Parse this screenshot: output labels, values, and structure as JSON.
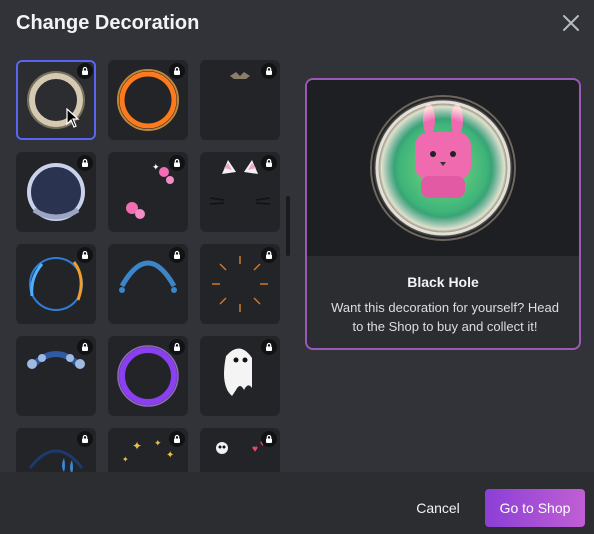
{
  "dialog": {
    "title": "Change Decoration",
    "close_icon": "close-icon"
  },
  "decorations": [
    {
      "id": "black-hole",
      "icon": "black-hole-ring",
      "locked": true,
      "selected": true
    },
    {
      "id": "fire-ring",
      "icon": "fire-ring",
      "locked": true,
      "selected": false
    },
    {
      "id": "small-crown",
      "icon": "tiara",
      "locked": true,
      "selected": false
    },
    {
      "id": "space-helmet",
      "icon": "astronaut-helmet",
      "locked": true,
      "selected": false
    },
    {
      "id": "pink-flowers",
      "icon": "pink-flowers",
      "locked": true,
      "selected": false
    },
    {
      "id": "cat-ears",
      "icon": "cat-ears-whiskers",
      "locked": true,
      "selected": false
    },
    {
      "id": "lightning-ring",
      "icon": "lightning-ring",
      "locked": true,
      "selected": false
    },
    {
      "id": "blue-dome",
      "icon": "blue-dome",
      "locked": true,
      "selected": false
    },
    {
      "id": "sparkle-burst",
      "icon": "sparkle-burst",
      "locked": true,
      "selected": false
    },
    {
      "id": "bubble-dome",
      "icon": "bubble-dome",
      "locked": true,
      "selected": false
    },
    {
      "id": "purple-ring",
      "icon": "purple-lightning-ring",
      "locked": true,
      "selected": false
    },
    {
      "id": "ghost",
      "icon": "ghost",
      "locked": true,
      "selected": false
    },
    {
      "id": "blue-drops",
      "icon": "blue-drops",
      "locked": true,
      "selected": false
    },
    {
      "id": "gold-stars",
      "icon": "gold-stars",
      "locked": true,
      "selected": false
    },
    {
      "id": "skull-hearts",
      "icon": "skull-hearts",
      "locked": true,
      "selected": false
    }
  ],
  "preview": {
    "name": "Black Hole",
    "description": "Want this decoration for yourself? Head to the Shop to buy and collect it!"
  },
  "footer": {
    "cancel_label": "Cancel",
    "shop_label": "Go to Shop"
  },
  "colors": {
    "accent": "#5865f2",
    "preview_border": "#9b59b6",
    "shop_gradient_start": "#8b3fd6",
    "shop_gradient_end": "#c05fd4"
  }
}
